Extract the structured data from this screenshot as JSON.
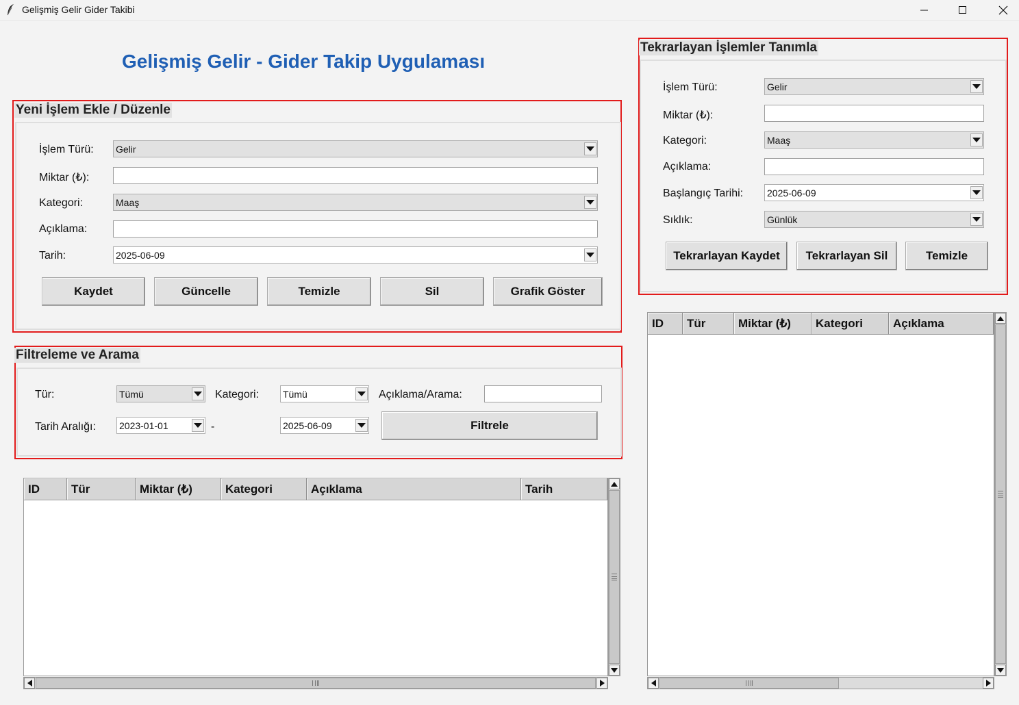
{
  "window": {
    "title": "Gelişmiş Gelir Gider Takibi"
  },
  "app_title": "Gelişmiş Gelir - Gider Takip Uygulaması",
  "add_edit": {
    "title": "Yeni İşlem Ekle / Düzenle",
    "labels": {
      "type": "İşlem Türü:",
      "amount": "Miktar (₺):",
      "category": "Kategori:",
      "description": "Açıklama:",
      "date": "Tarih:"
    },
    "values": {
      "type": "Gelir",
      "amount": "",
      "category": "Maaş",
      "description": "",
      "date": "2025-06-09"
    },
    "buttons": {
      "save": "Kaydet",
      "update": "Güncelle",
      "clear": "Temizle",
      "delete": "Sil",
      "chart": "Grafik Göster"
    }
  },
  "filter": {
    "title": "Filtreleme ve Arama",
    "labels": {
      "type": "Tür:",
      "category": "Kategori:",
      "search": "Açıklama/Arama:",
      "date_range": "Tarih Aralığı:",
      "dash": "-"
    },
    "values": {
      "type": "Tümü",
      "category": "Tümü",
      "search": "",
      "start": "2023-01-01",
      "end": "2025-06-09"
    },
    "button": "Filtrele"
  },
  "transactions_table": {
    "columns": [
      "ID",
      "Tür",
      "Miktar (₺)",
      "Kategori",
      "Açıklama",
      "Tarih"
    ],
    "rows": []
  },
  "recurring": {
    "title": "Tekrarlayan İşlemler Tanımla",
    "labels": {
      "type": "İşlem Türü:",
      "amount": "Miktar (₺):",
      "category": "Kategori:",
      "description": "Açıklama:",
      "start": "Başlangıç Tarihi:",
      "frequency": "Sıklık:"
    },
    "values": {
      "type": "Gelir",
      "amount": "",
      "category": "Maaş",
      "description": "",
      "start": "2025-06-09",
      "frequency": "Günlük"
    },
    "buttons": {
      "save": "Tekrarlayan Kaydet",
      "delete": "Tekrarlayan Sil",
      "clear": "Temizle"
    }
  },
  "recurring_table": {
    "columns": [
      "ID",
      "Tür",
      "Miktar (₺)",
      "Kategori",
      "Açıklama"
    ],
    "rows": []
  },
  "colors": {
    "accent": "#1f5fb4",
    "highlight_border": "#e21b1b"
  }
}
